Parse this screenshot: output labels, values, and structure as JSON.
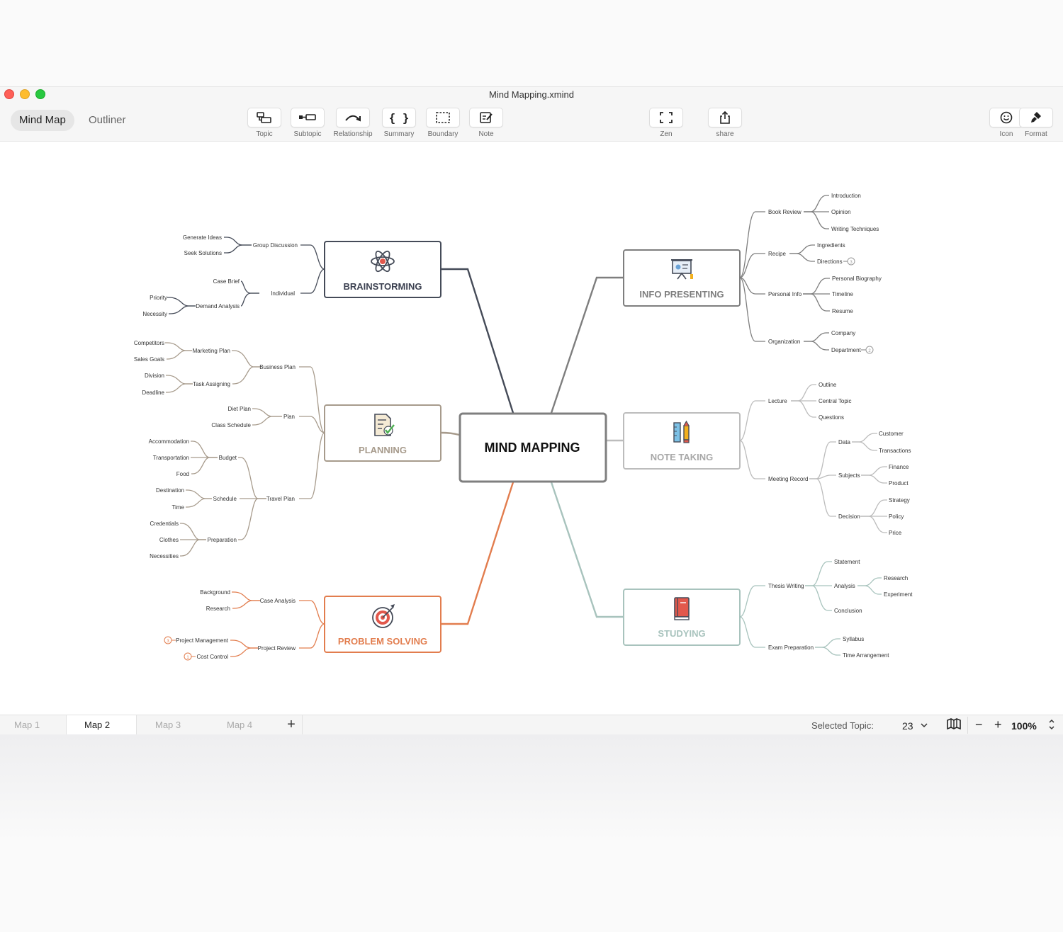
{
  "window": {
    "title": "Mind Mapping.xmind"
  },
  "view_tabs": [
    {
      "label": "Mind Map"
    },
    {
      "label": "Outliner"
    }
  ],
  "toolbar": {
    "topic": "Topic",
    "subtopic": "Subtopic",
    "relationship": "Relationship",
    "summary": "Summary",
    "boundary": "Boundary",
    "note": "Note",
    "zen": "Zen",
    "share": "share",
    "icon": "Icon",
    "format": "Format"
  },
  "mindmap": {
    "central": "MIND MAPPING",
    "colors": {
      "brainstorming": "#454b58",
      "planning": "#a79b8c",
      "problem": "#e27d4e",
      "info": "#7e7e7e",
      "note": "#bcbcbc",
      "studying": "#a8c3bd"
    },
    "branches": {
      "brainstorming": {
        "title": "BRAINSTORMING",
        "group_discussion": "Group Discussion",
        "generate_ideas": "Generate Ideas",
        "seek_solutions": "Seek Solutions",
        "individual": "Individual",
        "case_brief": "Case Brief",
        "demand_analysis": "Demand Analysis",
        "priority": "Priority",
        "necessity": "Necessity"
      },
      "planning": {
        "title": "PLANNING",
        "business_plan": "Business Plan",
        "marketing_plan": "Marketing Plan",
        "competitors": "Competitors",
        "sales_goals": "Sales Goals",
        "task_assigning": "Task Assigning",
        "division": "Division",
        "deadline": "Deadline",
        "plan": "Plan",
        "diet_plan": "Diet Plan",
        "class_schedule": "Class Schedule",
        "travel_plan": "Travel Plan",
        "budget": "Budget",
        "accommodation": "Accommodation",
        "transportation": "Transportation",
        "food": "Food",
        "schedule": "Schedule",
        "destination": "Destination",
        "time": "Time",
        "preparation": "Preparation",
        "credentials": "Credentials",
        "clothes": "Clothes",
        "necessities": "Necessities"
      },
      "problem_solving": {
        "title": "PROBLEM SOLVING",
        "case_analysis": "Case Analysis",
        "background": "Background",
        "research": "Research",
        "project_review": "Project Review",
        "project_management": "Project Management",
        "cost_control": "Cost Control",
        "pm_count": "3",
        "cc_count": "1"
      },
      "info_presenting": {
        "title": "INFO PRESENTING",
        "book_review": "Book Review",
        "introduction": "Introduction",
        "opinion": "Opinion",
        "writing_techniques": "Writing Techniques",
        "recipe": "Recipe",
        "ingredients": "Ingredients",
        "directions": "Directions",
        "directions_count": "3",
        "personal_info": "Personal Info",
        "personal_biography": "Personal Biography",
        "timeline": "Timeline",
        "resume": "Resume",
        "organization": "Organization",
        "company": "Company",
        "department": "Department",
        "department_count": "2"
      },
      "note_taking": {
        "title": "NOTE TAKING",
        "lecture": "Lecture",
        "outline": "Outline",
        "central_topic": "Central Topic",
        "questions": "Questions",
        "meeting_record": "Meeting Record",
        "data": "Data",
        "customer": "Customer",
        "transactions": "Transactions",
        "subjects": "Subjects",
        "finance": "Finance",
        "product": "Product",
        "decision": "Decision",
        "strategy": "Strategy",
        "policy": "Policy",
        "price": "Price"
      },
      "studying": {
        "title": "STUDYING",
        "thesis_writing": "Thesis Writing",
        "statement": "Statement",
        "analysis": "Analysis",
        "research": "Research",
        "experiment": "Experiment",
        "conclusion": "Conclusion",
        "exam_preparation": "Exam Preparation",
        "syllabus": "Syllabus",
        "time_arrangement": "Time Arrangement"
      }
    }
  },
  "sheets": [
    {
      "label": "Map 1"
    },
    {
      "label": "Map 2"
    },
    {
      "label": "Map 3"
    },
    {
      "label": "Map 4"
    }
  ],
  "status": {
    "selected_label": "Selected Topic:",
    "selected_count": "23",
    "zoom": "100%"
  }
}
